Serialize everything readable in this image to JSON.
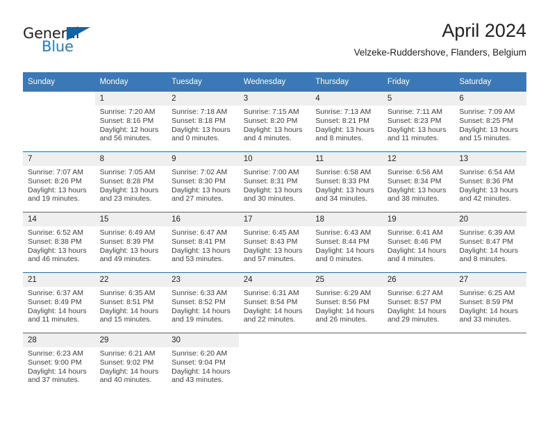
{
  "brand": {
    "name_part1": "General",
    "name_part2": "Blue",
    "triangle_icon": "triangle-icon",
    "colors": {
      "dark": "#231f20",
      "blue": "#1f7fc4",
      "triangle": "#1464a5"
    }
  },
  "header": {
    "month_title": "April 2024",
    "location": "Velzeke-Ruddershove, Flanders, Belgium"
  },
  "theme": {
    "header_bg": "#3b78b8",
    "header_text": "#ffffff",
    "row_divider": "#2e6da4",
    "daynum_bg": "#efefef",
    "body_text": "#3d3d3d"
  },
  "weekdays": [
    "Sunday",
    "Monday",
    "Tuesday",
    "Wednesday",
    "Thursday",
    "Friday",
    "Saturday"
  ],
  "weeks": [
    [
      {
        "day": "",
        "sunrise": "",
        "sunset": "",
        "daylight1": "",
        "daylight2": ""
      },
      {
        "day": "1",
        "sunrise": "Sunrise: 7:20 AM",
        "sunset": "Sunset: 8:16 PM",
        "daylight1": "Daylight: 12 hours",
        "daylight2": "and 56 minutes."
      },
      {
        "day": "2",
        "sunrise": "Sunrise: 7:18 AM",
        "sunset": "Sunset: 8:18 PM",
        "daylight1": "Daylight: 13 hours",
        "daylight2": "and 0 minutes."
      },
      {
        "day": "3",
        "sunrise": "Sunrise: 7:15 AM",
        "sunset": "Sunset: 8:20 PM",
        "daylight1": "Daylight: 13 hours",
        "daylight2": "and 4 minutes."
      },
      {
        "day": "4",
        "sunrise": "Sunrise: 7:13 AM",
        "sunset": "Sunset: 8:21 PM",
        "daylight1": "Daylight: 13 hours",
        "daylight2": "and 8 minutes."
      },
      {
        "day": "5",
        "sunrise": "Sunrise: 7:11 AM",
        "sunset": "Sunset: 8:23 PM",
        "daylight1": "Daylight: 13 hours",
        "daylight2": "and 11 minutes."
      },
      {
        "day": "6",
        "sunrise": "Sunrise: 7:09 AM",
        "sunset": "Sunset: 8:25 PM",
        "daylight1": "Daylight: 13 hours",
        "daylight2": "and 15 minutes."
      }
    ],
    [
      {
        "day": "7",
        "sunrise": "Sunrise: 7:07 AM",
        "sunset": "Sunset: 8:26 PM",
        "daylight1": "Daylight: 13 hours",
        "daylight2": "and 19 minutes."
      },
      {
        "day": "8",
        "sunrise": "Sunrise: 7:05 AM",
        "sunset": "Sunset: 8:28 PM",
        "daylight1": "Daylight: 13 hours",
        "daylight2": "and 23 minutes."
      },
      {
        "day": "9",
        "sunrise": "Sunrise: 7:02 AM",
        "sunset": "Sunset: 8:30 PM",
        "daylight1": "Daylight: 13 hours",
        "daylight2": "and 27 minutes."
      },
      {
        "day": "10",
        "sunrise": "Sunrise: 7:00 AM",
        "sunset": "Sunset: 8:31 PM",
        "daylight1": "Daylight: 13 hours",
        "daylight2": "and 30 minutes."
      },
      {
        "day": "11",
        "sunrise": "Sunrise: 6:58 AM",
        "sunset": "Sunset: 8:33 PM",
        "daylight1": "Daylight: 13 hours",
        "daylight2": "and 34 minutes."
      },
      {
        "day": "12",
        "sunrise": "Sunrise: 6:56 AM",
        "sunset": "Sunset: 8:34 PM",
        "daylight1": "Daylight: 13 hours",
        "daylight2": "and 38 minutes."
      },
      {
        "day": "13",
        "sunrise": "Sunrise: 6:54 AM",
        "sunset": "Sunset: 8:36 PM",
        "daylight1": "Daylight: 13 hours",
        "daylight2": "and 42 minutes."
      }
    ],
    [
      {
        "day": "14",
        "sunrise": "Sunrise: 6:52 AM",
        "sunset": "Sunset: 8:38 PM",
        "daylight1": "Daylight: 13 hours",
        "daylight2": "and 46 minutes."
      },
      {
        "day": "15",
        "sunrise": "Sunrise: 6:49 AM",
        "sunset": "Sunset: 8:39 PM",
        "daylight1": "Daylight: 13 hours",
        "daylight2": "and 49 minutes."
      },
      {
        "day": "16",
        "sunrise": "Sunrise: 6:47 AM",
        "sunset": "Sunset: 8:41 PM",
        "daylight1": "Daylight: 13 hours",
        "daylight2": "and 53 minutes."
      },
      {
        "day": "17",
        "sunrise": "Sunrise: 6:45 AM",
        "sunset": "Sunset: 8:43 PM",
        "daylight1": "Daylight: 13 hours",
        "daylight2": "and 57 minutes."
      },
      {
        "day": "18",
        "sunrise": "Sunrise: 6:43 AM",
        "sunset": "Sunset: 8:44 PM",
        "daylight1": "Daylight: 14 hours",
        "daylight2": "and 0 minutes."
      },
      {
        "day": "19",
        "sunrise": "Sunrise: 6:41 AM",
        "sunset": "Sunset: 8:46 PM",
        "daylight1": "Daylight: 14 hours",
        "daylight2": "and 4 minutes."
      },
      {
        "day": "20",
        "sunrise": "Sunrise: 6:39 AM",
        "sunset": "Sunset: 8:47 PM",
        "daylight1": "Daylight: 14 hours",
        "daylight2": "and 8 minutes."
      }
    ],
    [
      {
        "day": "21",
        "sunrise": "Sunrise: 6:37 AM",
        "sunset": "Sunset: 8:49 PM",
        "daylight1": "Daylight: 14 hours",
        "daylight2": "and 11 minutes."
      },
      {
        "day": "22",
        "sunrise": "Sunrise: 6:35 AM",
        "sunset": "Sunset: 8:51 PM",
        "daylight1": "Daylight: 14 hours",
        "daylight2": "and 15 minutes."
      },
      {
        "day": "23",
        "sunrise": "Sunrise: 6:33 AM",
        "sunset": "Sunset: 8:52 PM",
        "daylight1": "Daylight: 14 hours",
        "daylight2": "and 19 minutes."
      },
      {
        "day": "24",
        "sunrise": "Sunrise: 6:31 AM",
        "sunset": "Sunset: 8:54 PM",
        "daylight1": "Daylight: 14 hours",
        "daylight2": "and 22 minutes."
      },
      {
        "day": "25",
        "sunrise": "Sunrise: 6:29 AM",
        "sunset": "Sunset: 8:56 PM",
        "daylight1": "Daylight: 14 hours",
        "daylight2": "and 26 minutes."
      },
      {
        "day": "26",
        "sunrise": "Sunrise: 6:27 AM",
        "sunset": "Sunset: 8:57 PM",
        "daylight1": "Daylight: 14 hours",
        "daylight2": "and 29 minutes."
      },
      {
        "day": "27",
        "sunrise": "Sunrise: 6:25 AM",
        "sunset": "Sunset: 8:59 PM",
        "daylight1": "Daylight: 14 hours",
        "daylight2": "and 33 minutes."
      }
    ],
    [
      {
        "day": "28",
        "sunrise": "Sunrise: 6:23 AM",
        "sunset": "Sunset: 9:00 PM",
        "daylight1": "Daylight: 14 hours",
        "daylight2": "and 37 minutes."
      },
      {
        "day": "29",
        "sunrise": "Sunrise: 6:21 AM",
        "sunset": "Sunset: 9:02 PM",
        "daylight1": "Daylight: 14 hours",
        "daylight2": "and 40 minutes."
      },
      {
        "day": "30",
        "sunrise": "Sunrise: 6:20 AM",
        "sunset": "Sunset: 9:04 PM",
        "daylight1": "Daylight: 14 hours",
        "daylight2": "and 43 minutes."
      },
      {
        "day": "",
        "sunrise": "",
        "sunset": "",
        "daylight1": "",
        "daylight2": ""
      },
      {
        "day": "",
        "sunrise": "",
        "sunset": "",
        "daylight1": "",
        "daylight2": ""
      },
      {
        "day": "",
        "sunrise": "",
        "sunset": "",
        "daylight1": "",
        "daylight2": ""
      },
      {
        "day": "",
        "sunrise": "",
        "sunset": "",
        "daylight1": "",
        "daylight2": ""
      }
    ]
  ]
}
